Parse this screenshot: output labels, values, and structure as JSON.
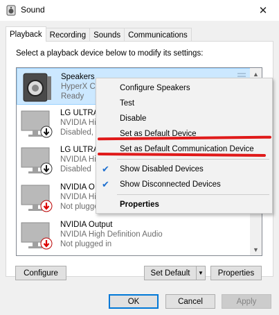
{
  "window": {
    "title": "Sound",
    "close_label": "✕",
    "icon": "speaker-icon"
  },
  "tabs": [
    {
      "label": "Playback",
      "active": true
    },
    {
      "label": "Recording"
    },
    {
      "label": "Sounds"
    },
    {
      "label": "Communications"
    }
  ],
  "instructions": "Select a playback device below to modify its settings:",
  "devices": [
    {
      "name": "Speakers",
      "sub": "HyperX Cl",
      "status": "Ready",
      "selected": true,
      "icon": "speaker-icon"
    },
    {
      "name": "LG ULTRAW",
      "sub": "NVIDIA Hi",
      "status": "Disabled,",
      "icon": "monitor-disabled-icon"
    },
    {
      "name": "LG ULTRAW",
      "sub": "NVIDIA Hi",
      "status": "Disabled",
      "icon": "monitor-disabled-icon"
    },
    {
      "name": "NVIDIA O",
      "sub": "NVIDIA Hi",
      "status": "Not plugge",
      "icon": "monitor-unplugged-icon"
    },
    {
      "name": "NVIDIA Output",
      "sub": "NVIDIA High Definition Audio",
      "status": "Not plugged in",
      "icon": "monitor-unplugged-icon"
    }
  ],
  "context_menu": {
    "items": [
      {
        "label": "Configure Speakers"
      },
      {
        "label": "Test"
      },
      {
        "label": "Disable"
      },
      {
        "label": "Set as Default Device"
      },
      {
        "label": "Set as Default Communication Device"
      },
      {
        "label": "Show Disabled Devices",
        "checked": true
      },
      {
        "label": "Show Disconnected Devices",
        "checked": true
      },
      {
        "label": "Properties",
        "bold": true
      }
    ],
    "check_glyph": "✔"
  },
  "panel_buttons": {
    "configure": "Configure",
    "set_default": "Set Default",
    "properties": "Properties"
  },
  "footer_buttons": {
    "ok": "OK",
    "cancel": "Cancel",
    "apply": "Apply"
  },
  "colors": {
    "selection": "#cce8ff",
    "annotation_red": "#e01a1a",
    "accent": "#0078d7"
  }
}
